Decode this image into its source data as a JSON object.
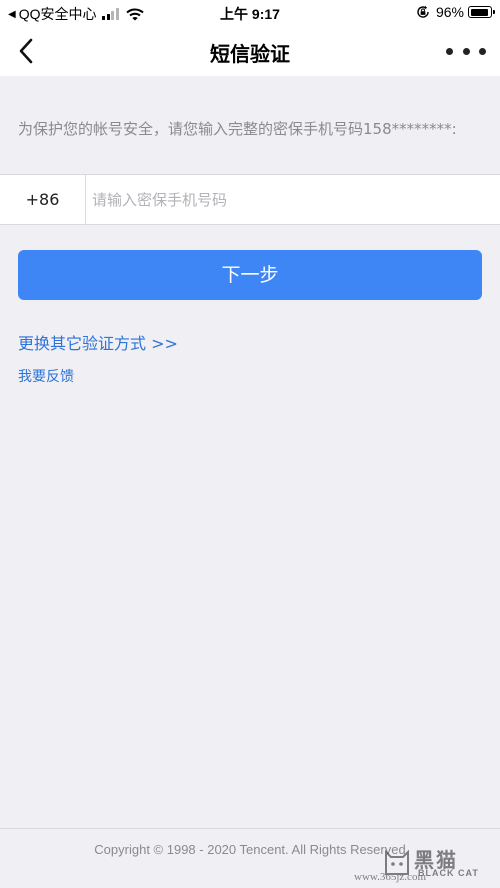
{
  "status_bar": {
    "back_glyph": "◀",
    "carrier": "QQ安全中心",
    "time": "上午 9:17",
    "battery_pct": "96%",
    "battery_level": 0.96,
    "signal_bars": 2
  },
  "nav": {
    "title": "短信验证"
  },
  "hint": {
    "text": "为保护您的帐号安全，请您输入完整的密保手机号码158********:"
  },
  "phone": {
    "country_code": "+86",
    "placeholder": "请输入密保手机号码",
    "value": ""
  },
  "buttons": {
    "next_label": "下一步"
  },
  "links": {
    "alt_method": "更换其它验证方式 >>",
    "feedback": "我要反馈"
  },
  "footer": {
    "copyright": "Copyright © 1998 - 2020 Tencent. All Rights Reserved"
  },
  "watermark": {
    "cn": "黑猫",
    "en": "BLACK CAT",
    "url": "www.365jz.com"
  },
  "colors": {
    "primary": "#3e86f6",
    "link": "#2e73d8",
    "background": "#efeff4"
  },
  "icons": [
    "back-chevron-icon",
    "more-icon",
    "wifi-icon",
    "signal-icon",
    "rotation-lock-icon",
    "battery-icon",
    "cat-logo-icon"
  ]
}
